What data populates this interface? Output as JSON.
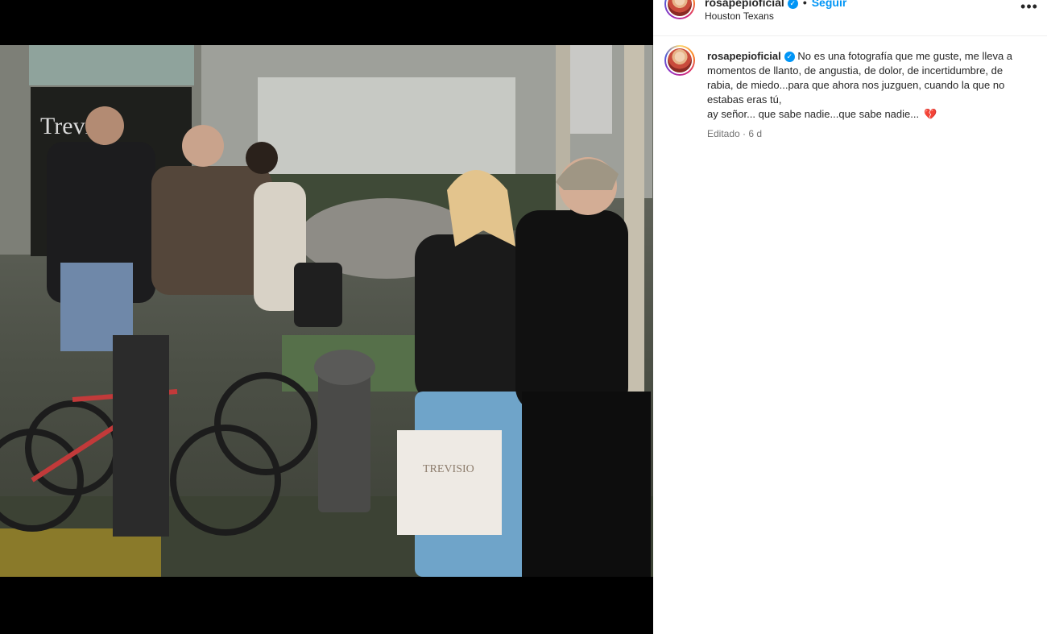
{
  "post": {
    "username": "rosapepioficial",
    "verified_icon": "verified-badge-icon",
    "follow_label": "Seguir",
    "separator": "•",
    "location": "Houston Texans",
    "more_icon": "more-options-icon",
    "more_glyph": "•••"
  },
  "caption": {
    "username": "rosapepioficial",
    "lines": [
      "No es una fotografía que me guste, me lleva a",
      "momentos de llanto, de angustia, de dolor, de incertidumbre, de",
      "rabia, de miedo...para que ahora nos juzguen, cuando la que no",
      "estabas eras tú,",
      "ay señor... que sabe nadie...que sabe nadie..."
    ],
    "emoji": "💔",
    "edited_label": "Editado",
    "time_ago": "6 d"
  },
  "media": {
    "sign_text": "Trevi",
    "bag_text": "TREVISIO"
  },
  "colors": {
    "accent": "#0095f6",
    "text": "#262626",
    "muted": "#737373",
    "heart": "#e0245e"
  }
}
